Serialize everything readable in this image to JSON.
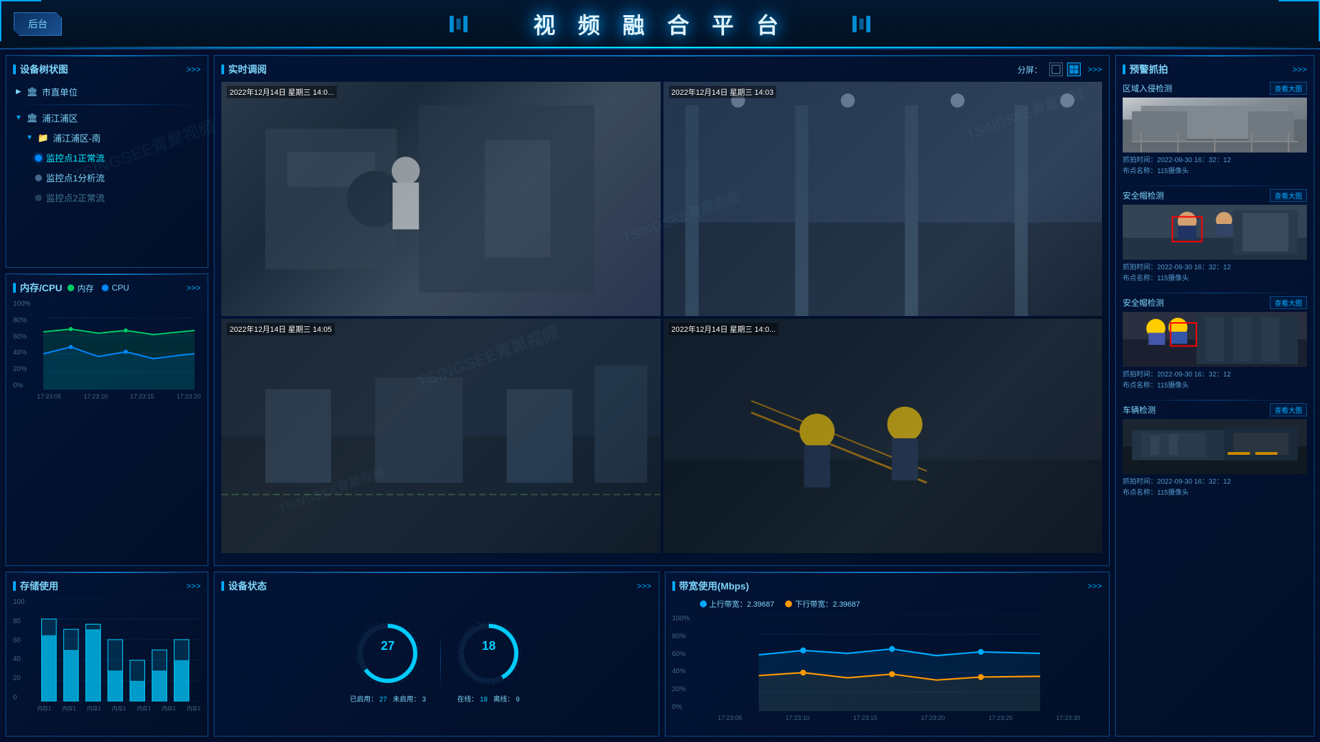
{
  "header": {
    "back_label": "后台",
    "title": "视 频 融 合 平 台"
  },
  "device_tree": {
    "title": "设备树状图",
    "more": ">>>",
    "items": [
      {
        "level": 1,
        "label": "市直单位",
        "type": "arrow",
        "collapsed": true
      },
      {
        "level": 1,
        "label": "浦江浦区",
        "type": "arrow",
        "collapsed": false
      },
      {
        "level": 2,
        "label": "浦江浦区-南",
        "type": "arrow",
        "collapsed": false
      },
      {
        "level": 3,
        "label": "监控点1正常流",
        "type": "dot-blue"
      },
      {
        "level": 3,
        "label": "监控点1分析流",
        "type": "dot-gray"
      },
      {
        "level": 3,
        "label": "监控点2正常流",
        "type": "dot-gray"
      }
    ]
  },
  "cpu_memory": {
    "title": "内存/CPU",
    "more": ">>>",
    "legend_memory": "内存",
    "legend_cpu": "CPU",
    "y_labels": [
      "100%",
      "80%",
      "60%",
      "40%",
      "20%",
      "0%"
    ],
    "x_labels": [
      "17:23:05",
      "17:23:10",
      "17:23:15",
      "17:23:20"
    ]
  },
  "storage": {
    "title": "存储使用",
    "more": ">>>",
    "y_labels": [
      "100",
      "80",
      "60",
      "40",
      "20",
      "0"
    ],
    "x_labels": [
      "内存1",
      "内存1",
      "内存1",
      "内存1",
      "内存1",
      "内存1",
      "内存1"
    ]
  },
  "realtime": {
    "title": "实时调阅",
    "more": ">>>",
    "split_label": "分屏：",
    "videos": [
      {
        "timestamp": "2022年12月14日 星期三 14:0..."
      },
      {
        "timestamp": "2022年12月14日 星期三 14:03"
      },
      {
        "timestamp": "2022年12月14日 星期三 14:05"
      },
      {
        "timestamp": "2022年12月14日 星期三 14:0..."
      }
    ]
  },
  "device_status": {
    "title": "设备状态",
    "more": ">>>",
    "active_count": 27,
    "active_label": "已启用：",
    "active_value": "27",
    "inactive_label": "未启用：",
    "inactive_value": "3",
    "online_count": 18,
    "online_label": "在线：",
    "online_value": "18",
    "offline_label": "离线：",
    "offline_value": "9"
  },
  "bandwidth": {
    "title": "带宽使用(Mbps)",
    "more": ">>>",
    "upload_label": "上行带宽：2.39687",
    "download_label": "下行带宽：2.39687",
    "y_labels": [
      "100%",
      "80%",
      "60%",
      "40%",
      "20%",
      "0%"
    ],
    "x_labels": [
      "17:23:05",
      "17:23:10",
      "17:23:15",
      "17:23:20",
      "17:23:25",
      "17:23:30"
    ]
  },
  "alert_capture": {
    "title": "预警抓拍",
    "more": ">>>",
    "sections": [
      {
        "title": "区域入侵检测",
        "view_btn": "查看大图",
        "capture_time": "抓拍时间：2022-09-30 16：32：12",
        "camera_label": "布点名称：115摄像头"
      },
      {
        "title": "安全帽检测",
        "view_btn": "查看大图",
        "capture_time": "抓拍时间：2022-09-30 16：32：12",
        "camera_label": "布点名称：115摄像头"
      },
      {
        "title": "安全帽检测",
        "view_btn": "查看大图",
        "capture_time": "抓拍时间：2022-09-30 16：32：12",
        "camera_label": "布点名称：115摄像头"
      },
      {
        "title": "车辆检测",
        "view_btn": "查看大图",
        "capture_time": "抓拍时间：2022-09-30 16：32：12",
        "camera_label": "布点名称：115摄像头"
      }
    ]
  },
  "watermarks": [
    "TSINGSEE青犀视频",
    "TSINGSEE青犀视频"
  ]
}
